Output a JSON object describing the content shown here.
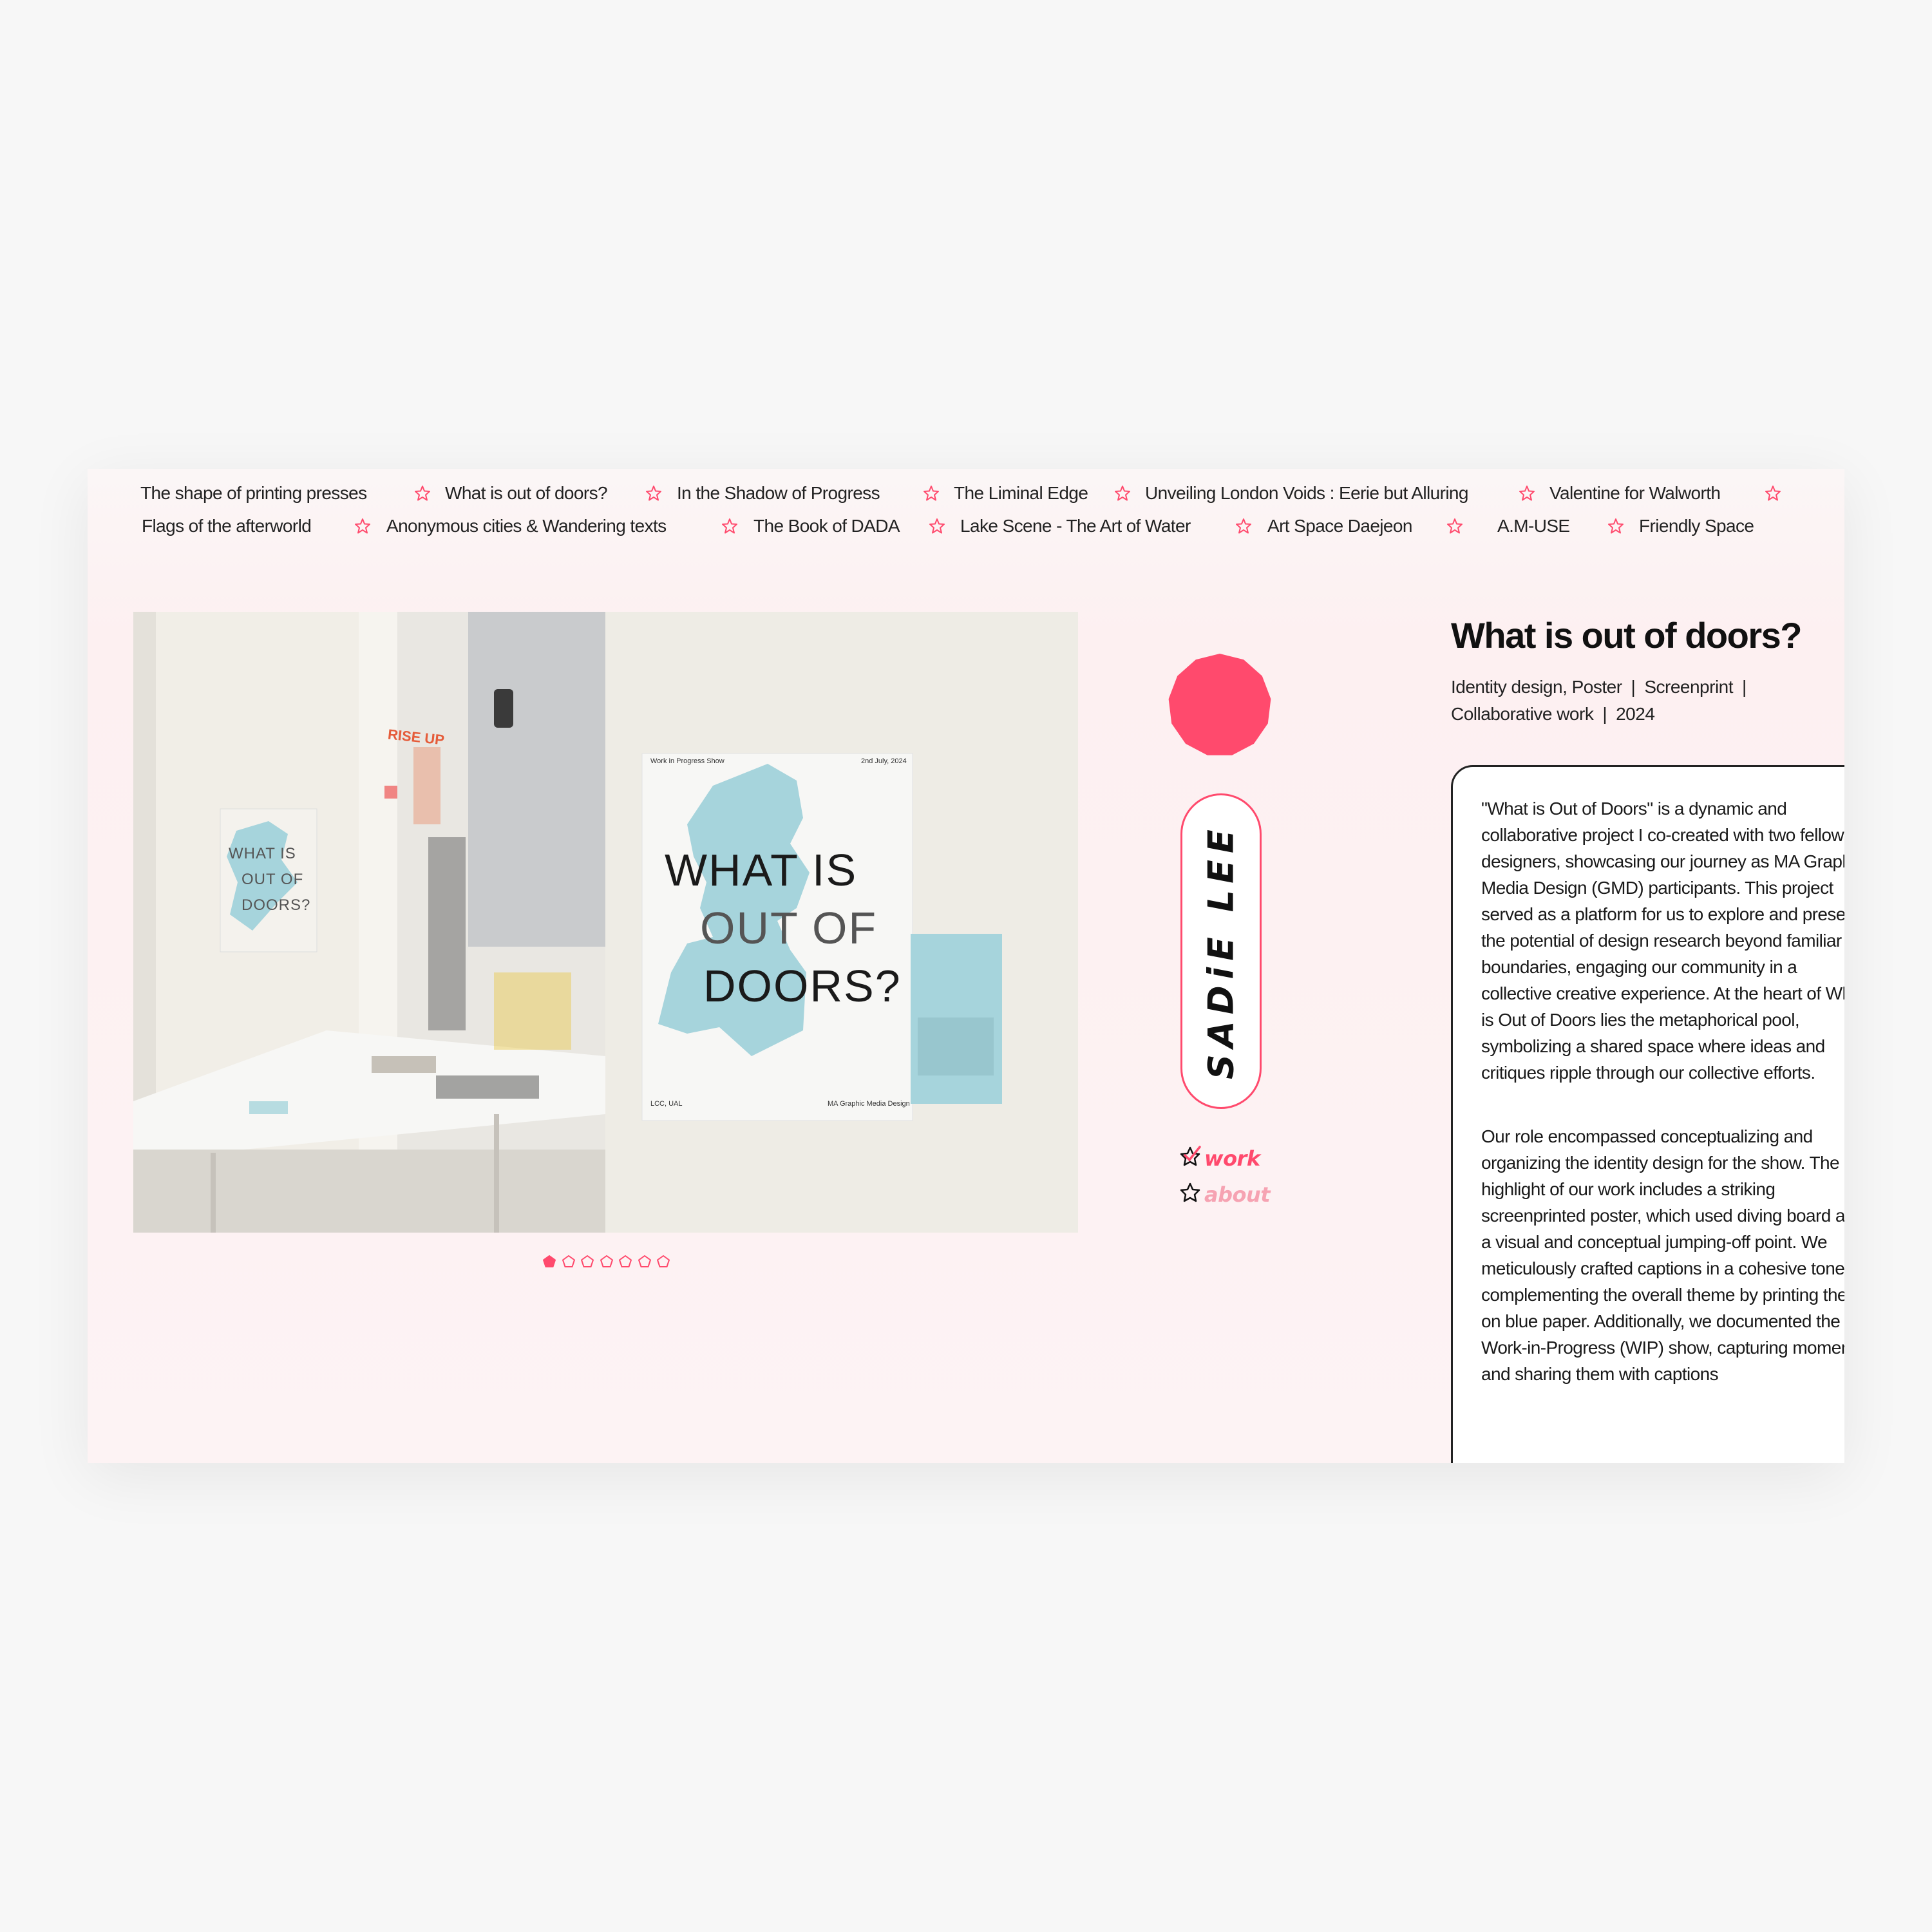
{
  "projects_row1": [
    "The shape of printing presses",
    "What is out of doors?",
    "In the Shadow of Progress",
    "The Liminal Edge",
    "Unveiling London Voids : Eerie but Alluring",
    "Valentine for Walworth"
  ],
  "projects_row2": [
    "Flags of the afterworld",
    "Anonymous cities & Wandering texts",
    "The Book of DADA",
    "Lake Scene - The Art of Water",
    "Art Space Daejeon",
    "A.M-USE",
    "Friendly Space"
  ],
  "gallery": {
    "total_slides": 7,
    "active_slide": 1,
    "poster": {
      "header_left": "Work in Progress Show",
      "header_right": "2nd July, 2024",
      "title_l1": "WHAT IS",
      "title_l2": "OUT OF",
      "title_l3": "DOORS?",
      "footer_left": "LCC, UAL",
      "footer_right": "MA Graphic Media Design"
    },
    "small_poster": {
      "l1": "WHAT IS",
      "l2": "OUT OF",
      "l3": "DOORS?"
    },
    "wall_sign": "RISE UP"
  },
  "brand": {
    "name": "SADiE LEE"
  },
  "menu": {
    "work": "work",
    "about": "about",
    "active": "work"
  },
  "project": {
    "title": "What is out of doors?",
    "tags": [
      "Identity design, Poster",
      "Screenprint",
      "Collaborative work",
      "2024"
    ],
    "description": [
      "\"What is Out of Doors\" is a dynamic and collaborative project I co-created with two fellow designers, showcasing our journey as MA Graphic Media Design (GMD) participants. This project served as a platform for us to explore and present the potential of design research beyond familiar boundaries, engaging our community in a collective creative experience. At the heart of What is Out of Doors lies the metaphorical pool, symbolizing a shared space where ideas and critiques ripple through our collective efforts.",
      "Our role encompassed conceptualizing and organizing the identity design for the show. The highlight of our work includes a striking screenprinted poster, which used diving board as a visual and conceptual jumping-off point. We meticulously crafted captions in a cohesive tone, complementing the overall theme by printing them on blue paper. Additionally, we documented the Work-in-Progress (WIP) show, capturing moments and sharing them with captions"
    ]
  },
  "colors": {
    "accent": "#ff4a6d",
    "pill_blue": "#a6d4dc",
    "bg": "#fdf0f1"
  }
}
